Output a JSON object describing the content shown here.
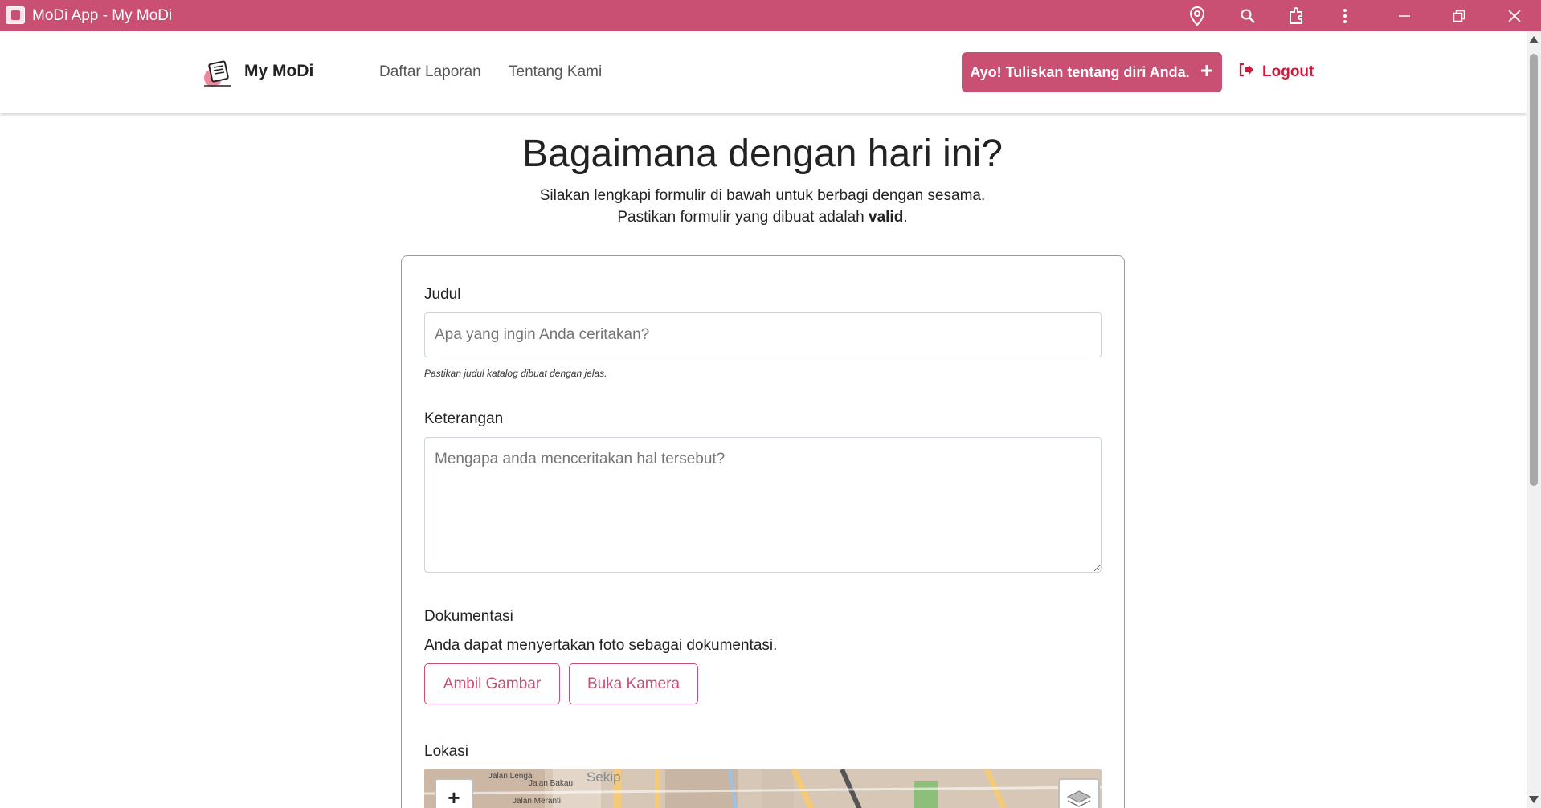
{
  "window": {
    "title": "MoDi App - My MoDi"
  },
  "navbar": {
    "brand": "My MoDi",
    "links": [
      "Daftar Laporan",
      "Tentang Kami"
    ],
    "cta_label": "Ayo! Tuliskan tentang diri Anda.",
    "logout_label": "Logout"
  },
  "hero": {
    "title": "Bagaimana dengan hari ini?",
    "subtitle_line1": "Silakan lengkapi formulir di bawah untuk berbagi dengan sesama.",
    "subtitle_line2_prefix": "Pastikan formulir yang dibuat adalah ",
    "subtitle_line2_bold": "valid",
    "subtitle_line2_suffix": "."
  },
  "form": {
    "title": {
      "label": "Judul",
      "placeholder": "Apa yang ingin Anda ceritakan?",
      "hint": "Pastikan judul katalog dibuat dengan jelas."
    },
    "description": {
      "label": "Keterangan",
      "placeholder": "Mengapa anda menceritakan hal tersebut?"
    },
    "documentation": {
      "label": "Dokumentasi",
      "text": "Anda dapat menyertakan foto sebagai dokumentasi.",
      "pick_image_label": "Ambil Gambar",
      "open_camera_label": "Buka Kamera"
    },
    "location": {
      "label": "Lokasi",
      "zoom_in_label": "+",
      "map_labels": [
        "Sekip",
        "Jalan Lengal",
        "Jalan Bakau",
        "Jalan Meranti"
      ]
    }
  },
  "colors": {
    "brand": "#c94f73",
    "logout": "#d4183c"
  }
}
